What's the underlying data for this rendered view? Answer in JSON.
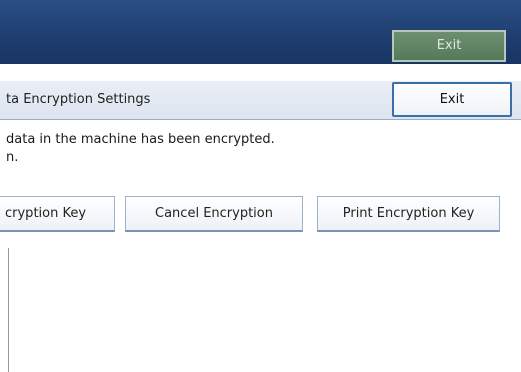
{
  "header": {
    "exit_label": "Exit"
  },
  "subheader": {
    "title": "ta Encryption Settings",
    "exit_label": "Exit"
  },
  "message": {
    "line1": "data in the machine has been encrypted.",
    "line2": "n."
  },
  "actions": {
    "update_key_label": "cryption Key",
    "cancel_label": "Cancel Encryption",
    "print_label": "Print Encryption Key"
  }
}
